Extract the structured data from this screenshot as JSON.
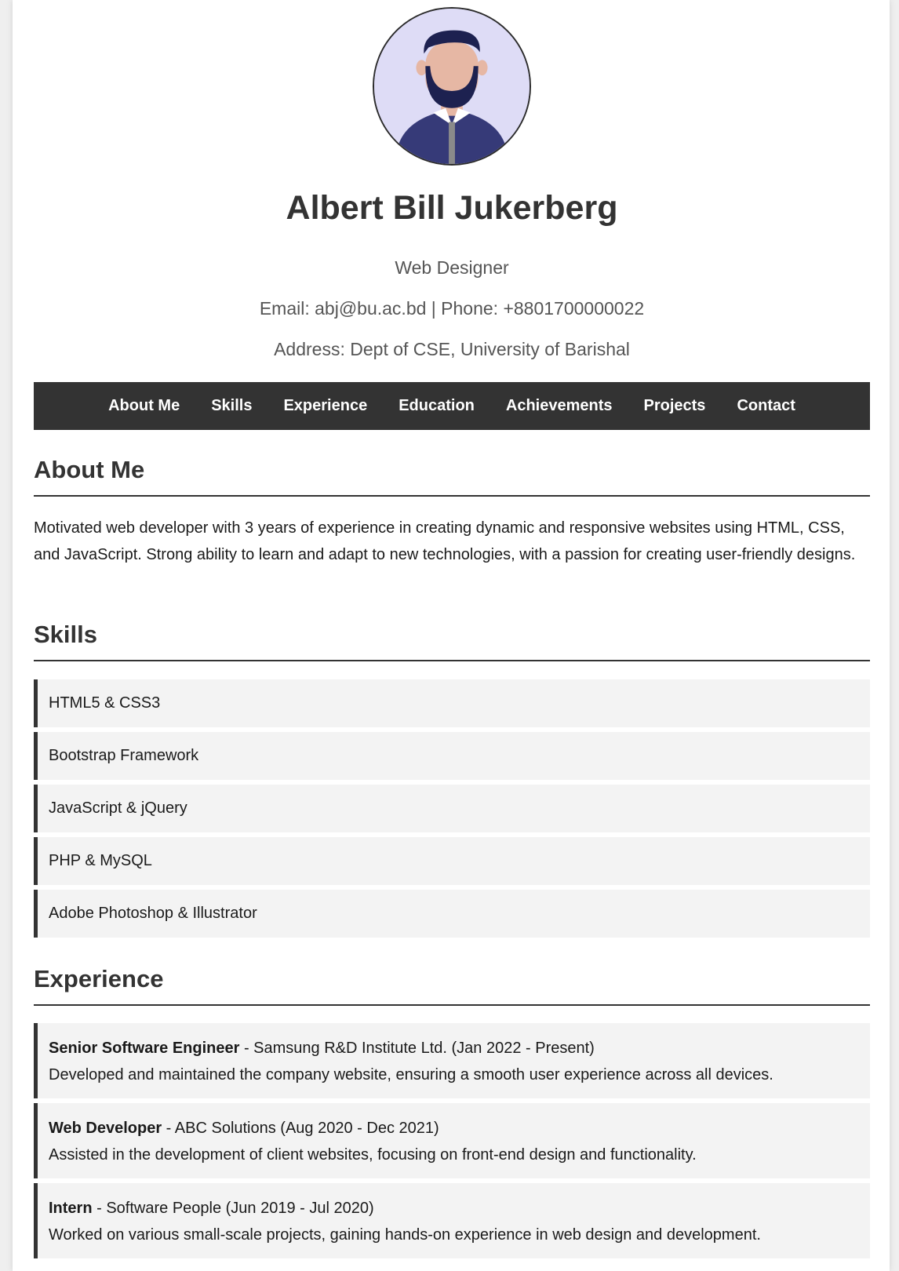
{
  "header": {
    "name": "Albert Bill Jukerberg",
    "title": "Web Designer",
    "contact": "Email: abj@bu.ac.bd | Phone: +8801700000022",
    "address": "Address: Dept of CSE, University of Barishal"
  },
  "nav": [
    {
      "label": "About Me"
    },
    {
      "label": "Skills"
    },
    {
      "label": "Experience"
    },
    {
      "label": "Education"
    },
    {
      "label": "Achievements"
    },
    {
      "label": "Projects"
    },
    {
      "label": "Contact"
    }
  ],
  "about": {
    "heading": "About Me",
    "text": "Motivated web developer with 3 years of experience in creating dynamic and responsive websites using HTML, CSS, and JavaScript. Strong ability to learn and adapt to new technologies, with a passion for creating user-friendly designs."
  },
  "skills": {
    "heading": "Skills",
    "items": [
      "HTML5 & CSS3",
      "Bootstrap Framework",
      "JavaScript & jQuery",
      "PHP & MySQL",
      "Adobe Photoshop & Illustrator"
    ]
  },
  "experience": {
    "heading": "Experience",
    "items": [
      {
        "role": "Senior Software Engineer",
        "details": " - Samsung R&D Institute Ltd. (Jan 2022 - Present)",
        "description": "Developed and maintained the company website, ensuring a smooth user experience across all devices."
      },
      {
        "role": "Web Developer",
        "details": " - ABC Solutions (Aug 2020 - Dec 2021)",
        "description": "Assisted in the development of client websites, focusing on front-end design and functionality."
      },
      {
        "role": "Intern",
        "details": " - Software People (Jun 2019 - Jul 2020)",
        "description": "Worked on various small-scale projects, gaining hands-on experience in web design and development."
      }
    ]
  },
  "icons": {
    "avatar": "person-avatar-illustration"
  },
  "colors": {
    "navbar": "#333333",
    "accent_border": "#333333",
    "item_background": "#f3f3f3",
    "avatar_background": "#dedcf6"
  }
}
